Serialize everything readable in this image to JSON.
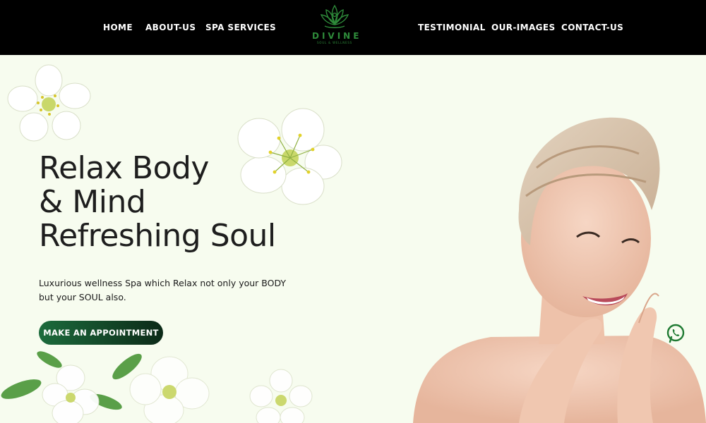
{
  "nav": {
    "left": [
      {
        "label": "HOME"
      },
      {
        "label": "ABOUT-US"
      },
      {
        "label": "SPA SERVICES"
      }
    ],
    "right": [
      {
        "label": "TESTIMONIAL"
      },
      {
        "label": "OUR-IMAGES"
      },
      {
        "label": "CONTACT-US"
      }
    ],
    "logo": {
      "word": "DIVINE",
      "tagline": "SOUL & WELLNESS"
    }
  },
  "hero": {
    "title_lines": [
      "Relax Body",
      "& Mind",
      "Refreshing Soul"
    ],
    "subtitle": "Luxurious wellness Spa which Relax not only your BODY but your SOUL also.",
    "cta_label": "MAKE AN APPOINTMENT"
  },
  "colors": {
    "nav_bg": "#000000",
    "hero_bg": "#f7fcef",
    "brand_green": "#2e8b3a",
    "cta_gradient_start": "#1c6b3c",
    "cta_gradient_end": "#0c2a18"
  },
  "icons": {
    "logo": "lotus-icon",
    "chat": "whatsapp-icon"
  }
}
